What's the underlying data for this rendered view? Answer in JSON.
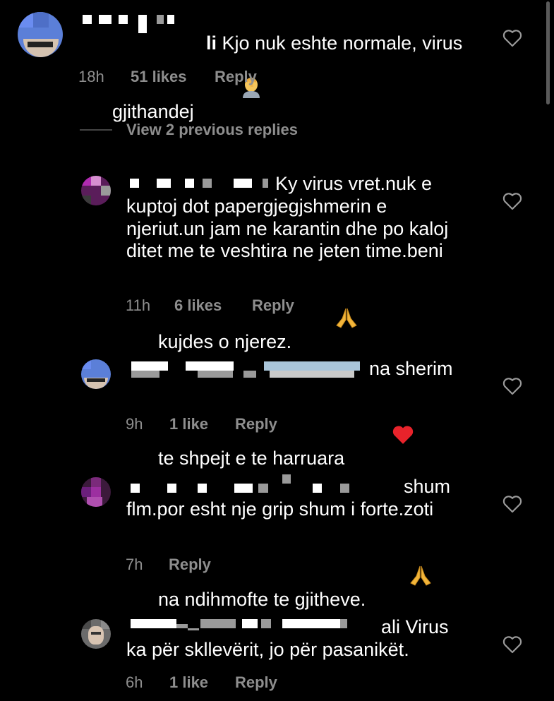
{
  "comments": [
    {
      "id": "c1",
      "username_tail": "li",
      "lines": [
        "Kjo nuk eshte normale, virus",
        "gjithandej"
      ],
      "time": "18h",
      "likes": "51 likes",
      "reply": "Reply",
      "emoji": "facepalm"
    },
    {
      "id": "c2",
      "lines": [
        "Ky virus vret.nuk e",
        "kuptoj dot papergjegjshmerin e",
        "njeriut.un jam ne karantin dhe po kaloj",
        "ditet me te veshtira ne jeten time.beni",
        "kujdes o njerez."
      ],
      "time": "11h",
      "likes": "6 likes",
      "reply": "Reply",
      "emoji": "pray"
    },
    {
      "id": "c3",
      "lines": [
        "na sherim",
        "te shpejt e te harruara"
      ],
      "time": "9h",
      "likes": "1 like",
      "reply": "Reply",
      "emoji": "red-heart"
    },
    {
      "id": "c4",
      "lines": [
        "shum",
        "flm.por esht nje grip shum i forte.zoti",
        "na ndihmofte te gjitheve."
      ],
      "time": "7h",
      "likes": "",
      "reply": "Reply",
      "emoji": "pray"
    },
    {
      "id": "c5",
      "lines": [
        "ali Virus",
        "ka për skllevërit, jo për pasanikët."
      ],
      "time": "6h",
      "likes": "1 like",
      "reply": "Reply",
      "emoji": ""
    }
  ],
  "view_replies": "View 2 previous replies",
  "colors": {
    "background": "#000000",
    "text": "#ffffff",
    "meta": "#8e8e8e",
    "heart_emoji": "#e8232b",
    "pray_emoji": "#f2b53a"
  }
}
